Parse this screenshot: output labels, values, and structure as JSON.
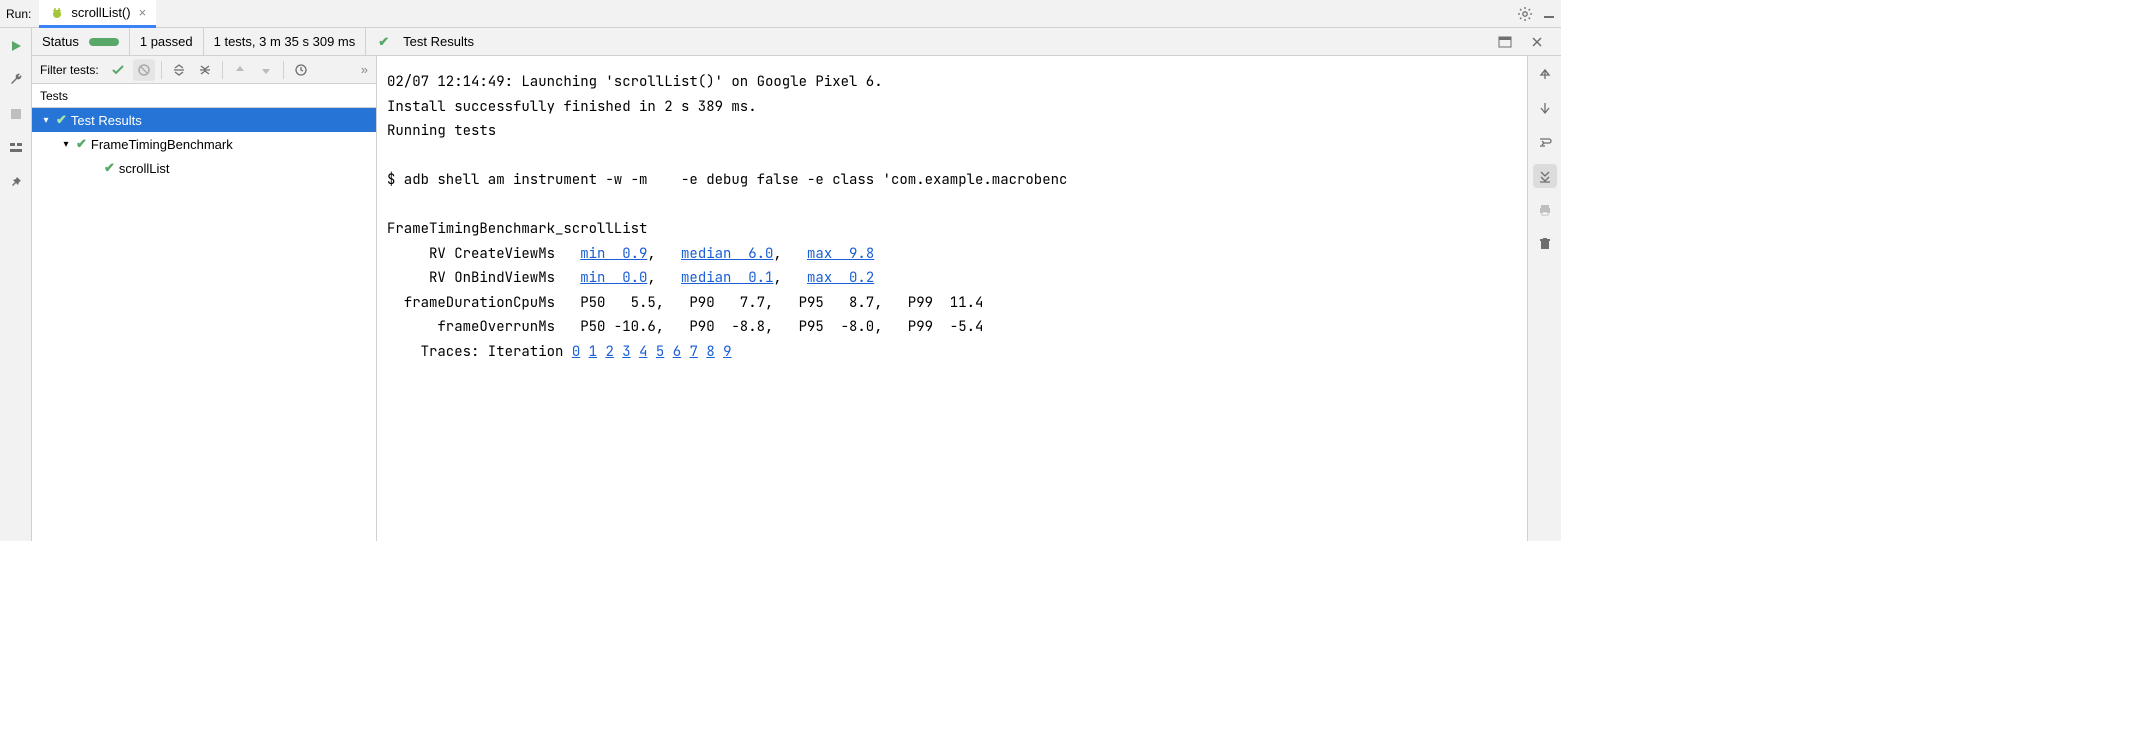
{
  "header": {
    "run_label": "Run:",
    "tab_name": "scrollList()"
  },
  "status": {
    "status_label": "Status",
    "passed_text": "1 passed",
    "summary": "1 tests, 3 m 35 s 309 ms",
    "right_title": "Test Results"
  },
  "filter": {
    "label": "Filter tests:",
    "more": "»"
  },
  "tests_header": "Tests",
  "tree": {
    "root": "Test Results",
    "class": "FrameTimingBenchmark",
    "method": "scrollList"
  },
  "console": {
    "line1": "02/07 12:14:49: Launching 'scrollList()' on Google Pixel 6.",
    "line2": "Install successfully finished in 2 s 389 ms.",
    "line3": "Running tests",
    "line4": "",
    "line5": "$ adb shell am instrument -w -m    -e debug false -e class 'com.example.macrobenc",
    "line6": "",
    "line7": "FrameTimingBenchmark_scrollList",
    "rv_create_label": "     RV CreateViewMs   ",
    "rv_create_min": "min  0.9",
    "rv_create_med": "median  6.0",
    "rv_create_max": "max  9.8",
    "rv_bind_label": "     RV OnBindViewMs   ",
    "rv_bind_min": "min  0.0",
    "rv_bind_med": "median  0.1",
    "rv_bind_max": "max  0.2",
    "cpu_line": "  frameDurationCpuMs   P50   5.5,   P90   7.7,   P95   8.7,   P99  11.4",
    "overrun_line": "      frameOverrunMs   P50 -10.6,   P90  -8.8,   P95  -8.0,   P99  -5.4",
    "traces_label": "    Traces: Iteration ",
    "iterations": [
      "0",
      "1",
      "2",
      "3",
      "4",
      "5",
      "6",
      "7",
      "8",
      "9"
    ]
  }
}
